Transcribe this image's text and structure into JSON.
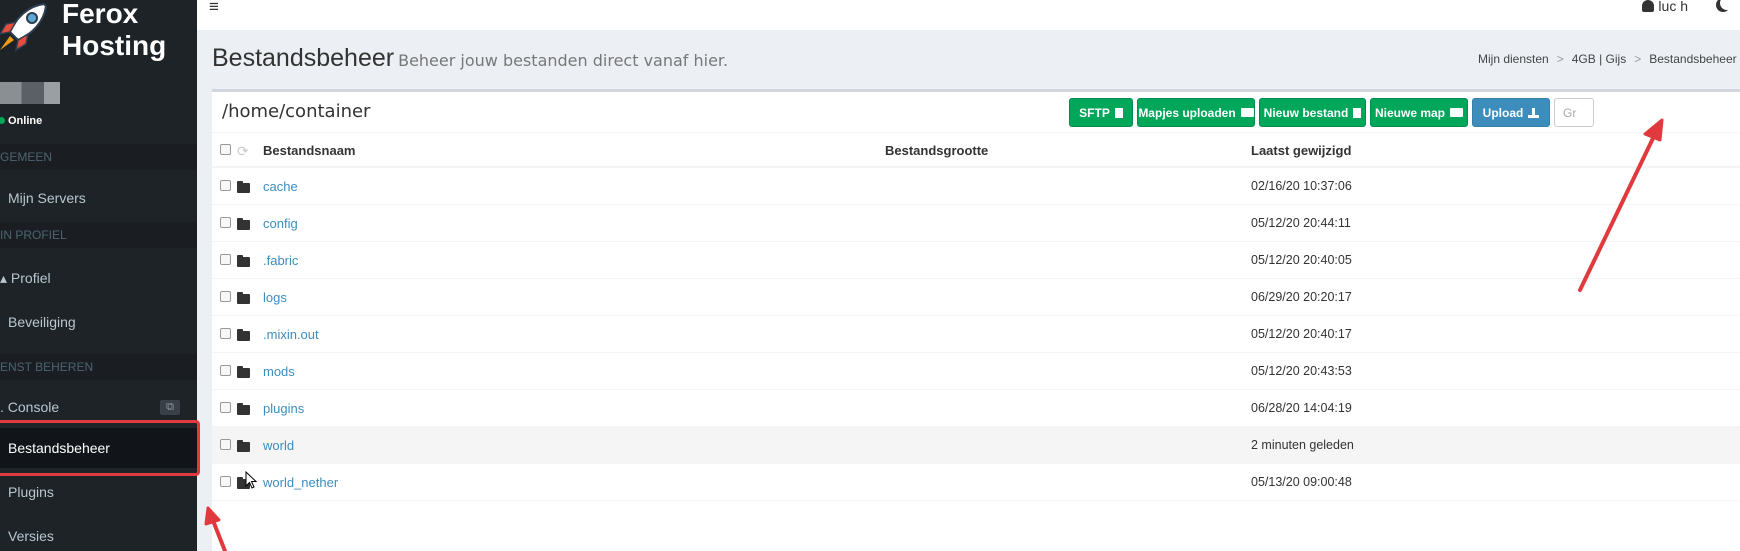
{
  "brand": {
    "line1": "Ferox",
    "line2": "Hosting"
  },
  "server": {
    "status": "Online"
  },
  "sidebar": {
    "sections": [
      {
        "header": "GEMEEN",
        "items": [
          {
            "label": "Mijn Servers"
          }
        ]
      },
      {
        "header": "IN PROFIEL",
        "items": [
          {
            "label": "Profiel"
          },
          {
            "label": "Beveiliging"
          }
        ]
      },
      {
        "header": "ENST BEHEREN",
        "items": [
          {
            "label": "Console"
          },
          {
            "label": "Bestandsbeheer"
          },
          {
            "label": "Plugins"
          },
          {
            "label": "Versies"
          }
        ]
      }
    ]
  },
  "topbar": {
    "user": "luc h"
  },
  "header": {
    "title": "Bestandsbeheer",
    "subtitle": "Beheer jouw bestanden direct vanaf hier.",
    "breadcrumb": [
      "Mijn diensten",
      "4GB | Gijs",
      "Bestandsbeheer"
    ]
  },
  "filemanager": {
    "path": "/home/container",
    "buttons": {
      "sftp": "SFTP",
      "upload_folders": "Mapjes uploaden",
      "new_file": "Nieuw bestand",
      "new_folder": "Nieuwe map",
      "upload": "Upload",
      "partial": "Gr"
    },
    "columns": {
      "name": "Bestandsnaam",
      "size": "Bestandsgrootte",
      "modified": "Laatst gewijzigd"
    },
    "rows": [
      {
        "name": "cache",
        "modified": "02/16/20 10:37:06"
      },
      {
        "name": "config",
        "modified": "05/12/20 20:44:11"
      },
      {
        "name": ".fabric",
        "modified": "05/12/20 20:40:05"
      },
      {
        "name": "logs",
        "modified": "06/29/20 20:20:17"
      },
      {
        "name": ".mixin.out",
        "modified": "05/12/20 20:40:17"
      },
      {
        "name": "mods",
        "modified": "05/12/20 20:43:53"
      },
      {
        "name": "plugins",
        "modified": "06/28/20 14:04:19"
      },
      {
        "name": "world",
        "modified": "2 minuten geleden"
      },
      {
        "name": "world_nether",
        "modified": "05/13/20 09:00:48"
      }
    ]
  },
  "colors": {
    "green": "#00a65a",
    "blue": "#3c8dbc",
    "sidebar": "#1e2328",
    "annotation": "#e0393e"
  }
}
